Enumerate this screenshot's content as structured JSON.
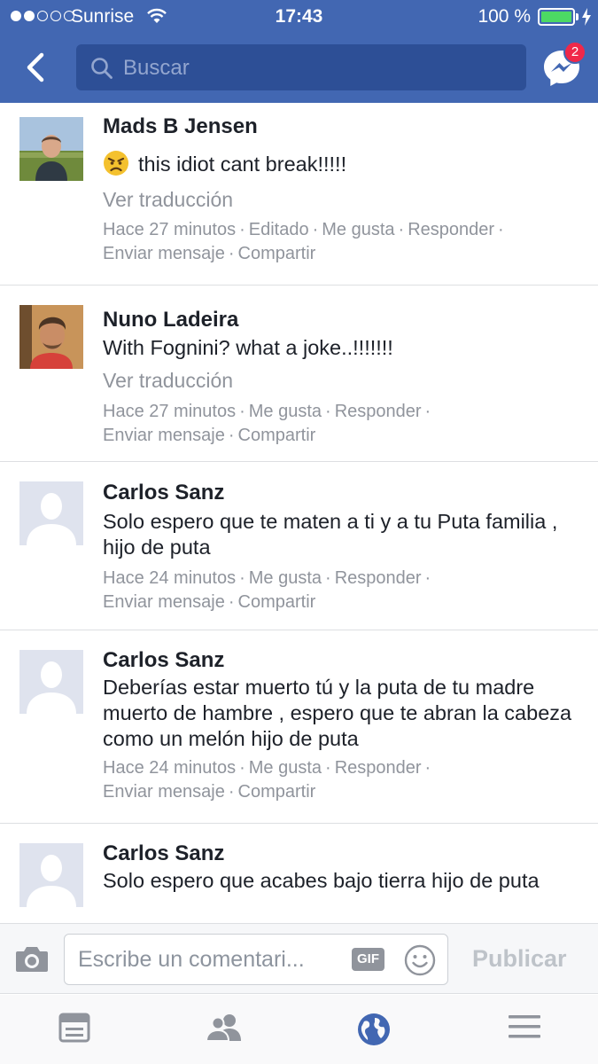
{
  "status_bar": {
    "carrier": "Sunrise",
    "time": "17:43",
    "battery": "100 %",
    "battery_level": 1.0,
    "signal_bars_filled": 2,
    "signal_bars_total": 5
  },
  "nav": {
    "search_placeholder": "Buscar",
    "messenger_badge": "2"
  },
  "comments": [
    {
      "name": "Mads B Jensen",
      "text": "this idiot cant break!!!!!",
      "emoji": "angry-face-emoji",
      "translate": "Ver traducción",
      "time": "Hace 27 minutos",
      "edited": "Editado",
      "like": "Me gusta",
      "reply": "Responder",
      "message": "Enviar mensaje",
      "share": "Compartir"
    },
    {
      "name": "Nuno Ladeira",
      "text": "With Fognini? what a joke..!!!!!!!",
      "translate": "Ver traducción",
      "time": "Hace 27 minutos",
      "like": "Me gusta",
      "reply": "Responder",
      "message": "Enviar mensaje",
      "share": "Compartir"
    },
    {
      "name": "Carlos Sanz",
      "text": "Solo espero que te maten a ti y a tu Puta familia , hijo de puta",
      "time": "Hace 24 minutos",
      "like": "Me gusta",
      "reply": "Responder",
      "message": "Enviar mensaje",
      "share": "Compartir"
    },
    {
      "name": "Carlos Sanz",
      "text": "Deberías estar muerto tú y la puta de tu madre muerto de hambre , espero que te abran la cabeza como un melón hijo de puta",
      "time": "Hace 24 minutos",
      "like": "Me gusta",
      "reply": "Responder",
      "message": "Enviar mensaje",
      "share": "Compartir"
    },
    {
      "name": "Carlos Sanz",
      "text": "Solo espero que acabes bajo tierra hijo de puta"
    }
  ],
  "composer": {
    "placeholder": "Escribe un comentari...",
    "gif_label": "GIF",
    "publish_label": "Publicar"
  },
  "tabbar": {
    "items": [
      "news-feed-icon",
      "friends-icon",
      "notifications-globe-icon",
      "menu-icon"
    ],
    "active": "notifications-globe-icon"
  },
  "colors": {
    "header": "#4267b2",
    "search_field": "#2d4f96",
    "badge": "#f02849",
    "meta_text": "#90949c",
    "active_tab": "#4267b2"
  }
}
